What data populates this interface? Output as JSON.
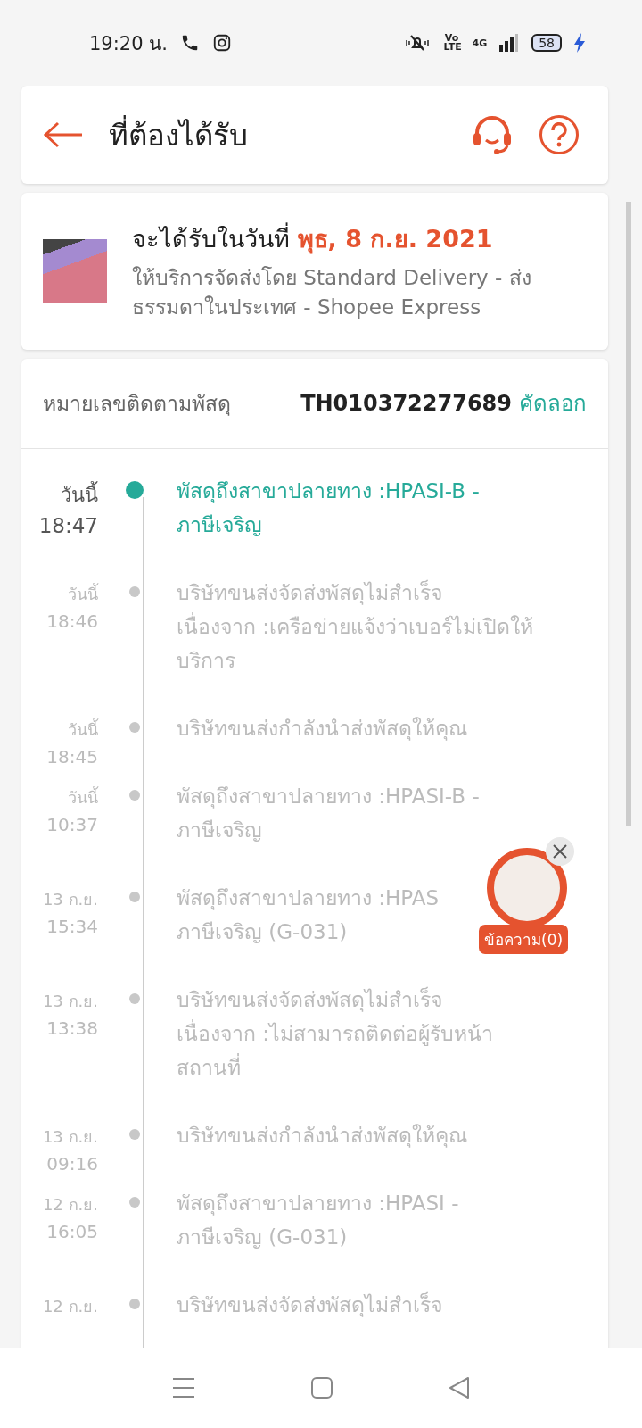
{
  "status_bar": {
    "time": "19:20 น.",
    "volte": "Vo LTE",
    "network": "4G",
    "battery": "58"
  },
  "header": {
    "title": "ที่ต้องได้รับ"
  },
  "delivery": {
    "label": "จะได้รับในวันที่",
    "date": "พุธ, 8 ก.ย. 2021",
    "service": "ให้บริการจัดส่งโดย Standard Delivery - ส่งธรรมดาในประเทศ - Shopee Express"
  },
  "tracking": {
    "label": "หมายเลขติดตามพัสดุ",
    "number": "TH010372277689",
    "copy": "คัดลอก"
  },
  "events": [
    {
      "date": "วันนี้",
      "time": "18:47",
      "lines": [
        "พัสดุถึงสาขาปลายทาง :HPASI-B -",
        "ภาษีเจริญ"
      ],
      "current": true
    },
    {
      "date": "วันนี้",
      "time": "18:46",
      "lines": [
        "บริษัทขนส่งจัดส่งพัสดุไม่สำเร็จ",
        "เนื่องจาก :เครือข่ายแจ้งว่าเบอร์ไม่เปิดให้",
        "บริการ"
      ],
      "current": false
    },
    {
      "date": "วันนี้",
      "time": "18:45",
      "lines": [
        "บริษัทขนส่งกำลังนำส่งพัสดุให้คุณ"
      ],
      "current": false
    },
    {
      "date": "วันนี้",
      "time": "10:37",
      "lines": [
        "พัสดุถึงสาขาปลายทาง :HPASI-B -",
        "ภาษีเจริญ"
      ],
      "current": false
    },
    {
      "date": "13 ก.ย.",
      "time": "15:34",
      "lines": [
        "พัสดุถึงสาขาปลายทาง :HPAS",
        "ภาษีเจริญ (G-031)"
      ],
      "current": false
    },
    {
      "date": "13 ก.ย.",
      "time": "13:38",
      "lines": [
        "บริษัทขนส่งจัดส่งพัสดุไม่สำเร็จ",
        "เนื่องจาก :ไม่สามารถติดต่อผู้รับหน้า",
        "สถานที่"
      ],
      "current": false
    },
    {
      "date": "13 ก.ย.",
      "time": "09:16",
      "lines": [
        "บริษัทขนส่งกำลังนำส่งพัสดุให้คุณ"
      ],
      "current": false
    },
    {
      "date": "12 ก.ย.",
      "time": "16:05",
      "lines": [
        "พัสดุถึงสาขาปลายทาง :HPASI -",
        "ภาษีเจริญ (G-031)"
      ],
      "current": false
    },
    {
      "date": "12 ก.ย.",
      "lines": [
        "บริษัทขนส่งจัดส่งพัสดุไม่สำเร็จ"
      ],
      "current": false
    }
  ],
  "chat_bubble": {
    "label": "ข้อความ(0)"
  }
}
